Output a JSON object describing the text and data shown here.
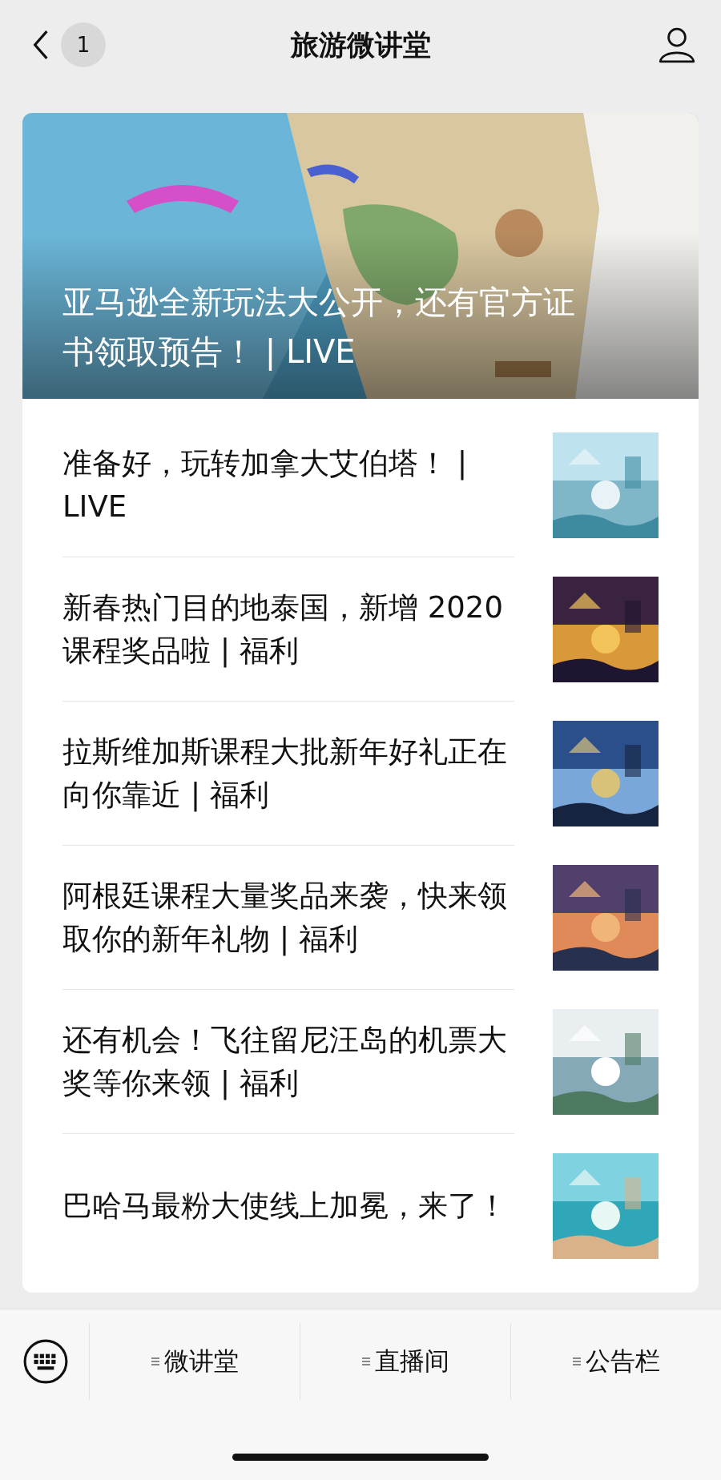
{
  "header": {
    "back_count": "1",
    "title": "旅游微讲堂"
  },
  "featured": {
    "title": "亚马逊全新玩法大公开，还有官方证书领取预告！ | LIVE"
  },
  "articles": [
    {
      "title": "准备好，玩转加拿大艾伯塔！ | LIVE"
    },
    {
      "title": "新春热门目的地泰国，新增 2020 课程奖品啦 | 福利"
    },
    {
      "title": "拉斯维加斯课程大批新年好礼正在向你靠近 | 福利"
    },
    {
      "title": "阿根廷课程大量奖品来袭，快来领取你的新年礼物 | 福利"
    },
    {
      "title": "还有机会！飞往留尼汪岛的机票大奖等你来领 | 福利"
    },
    {
      "title": "巴哈马最粉大使线上加冕，来了！"
    }
  ],
  "menu": [
    {
      "label": "微讲堂"
    },
    {
      "label": "直播间"
    },
    {
      "label": "公告栏"
    }
  ]
}
